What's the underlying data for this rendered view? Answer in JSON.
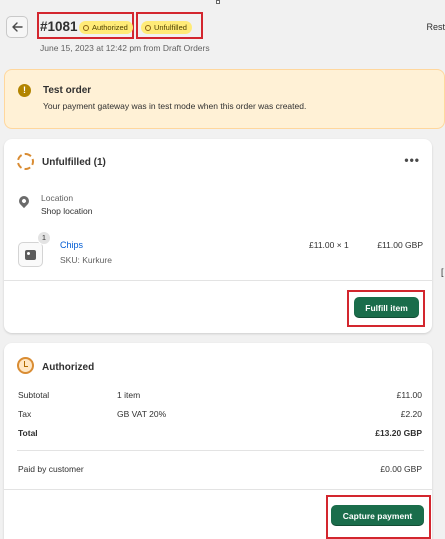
{
  "header": {
    "order_id": "#1081",
    "payment_badge": "Authorized",
    "fulfillment_badge": "Unfulfilled",
    "subline": "June 15, 2023 at 12:42 pm from Draft Orders",
    "right_link": "Rest"
  },
  "banner": {
    "title": "Test order",
    "description": "Your payment gateway was in test mode when this order was created."
  },
  "fulfillment_card": {
    "title": "Unfulfilled (1)",
    "more": "•••",
    "location_label": "Location",
    "location_value": "Shop location",
    "item": {
      "quantity_badge": "1",
      "name": "Chips",
      "sku": "SKU: Kurkure",
      "unit_price": "£11.00 × 1",
      "total": "£11.00 GBP"
    },
    "fulfill_button": "Fulfill item"
  },
  "payment_card": {
    "title": "Authorized",
    "rows": [
      {
        "label": "Subtotal",
        "mid": "1 item",
        "value": "£11.00"
      },
      {
        "label": "Tax",
        "mid": "GB VAT 20%",
        "value": "£2.20"
      },
      {
        "label": "Total",
        "mid": "",
        "value": "£13.20 GBP"
      }
    ],
    "paid_label": "Paid by customer",
    "paid_value": "£0.00 GBP",
    "capture_button": "Capture payment"
  },
  "colors": {
    "primary_button": "#1a6d4b",
    "highlight_outline": "#d3262e",
    "banner_bg": "#fff1d6",
    "badge_bg": "#ffeb78"
  }
}
